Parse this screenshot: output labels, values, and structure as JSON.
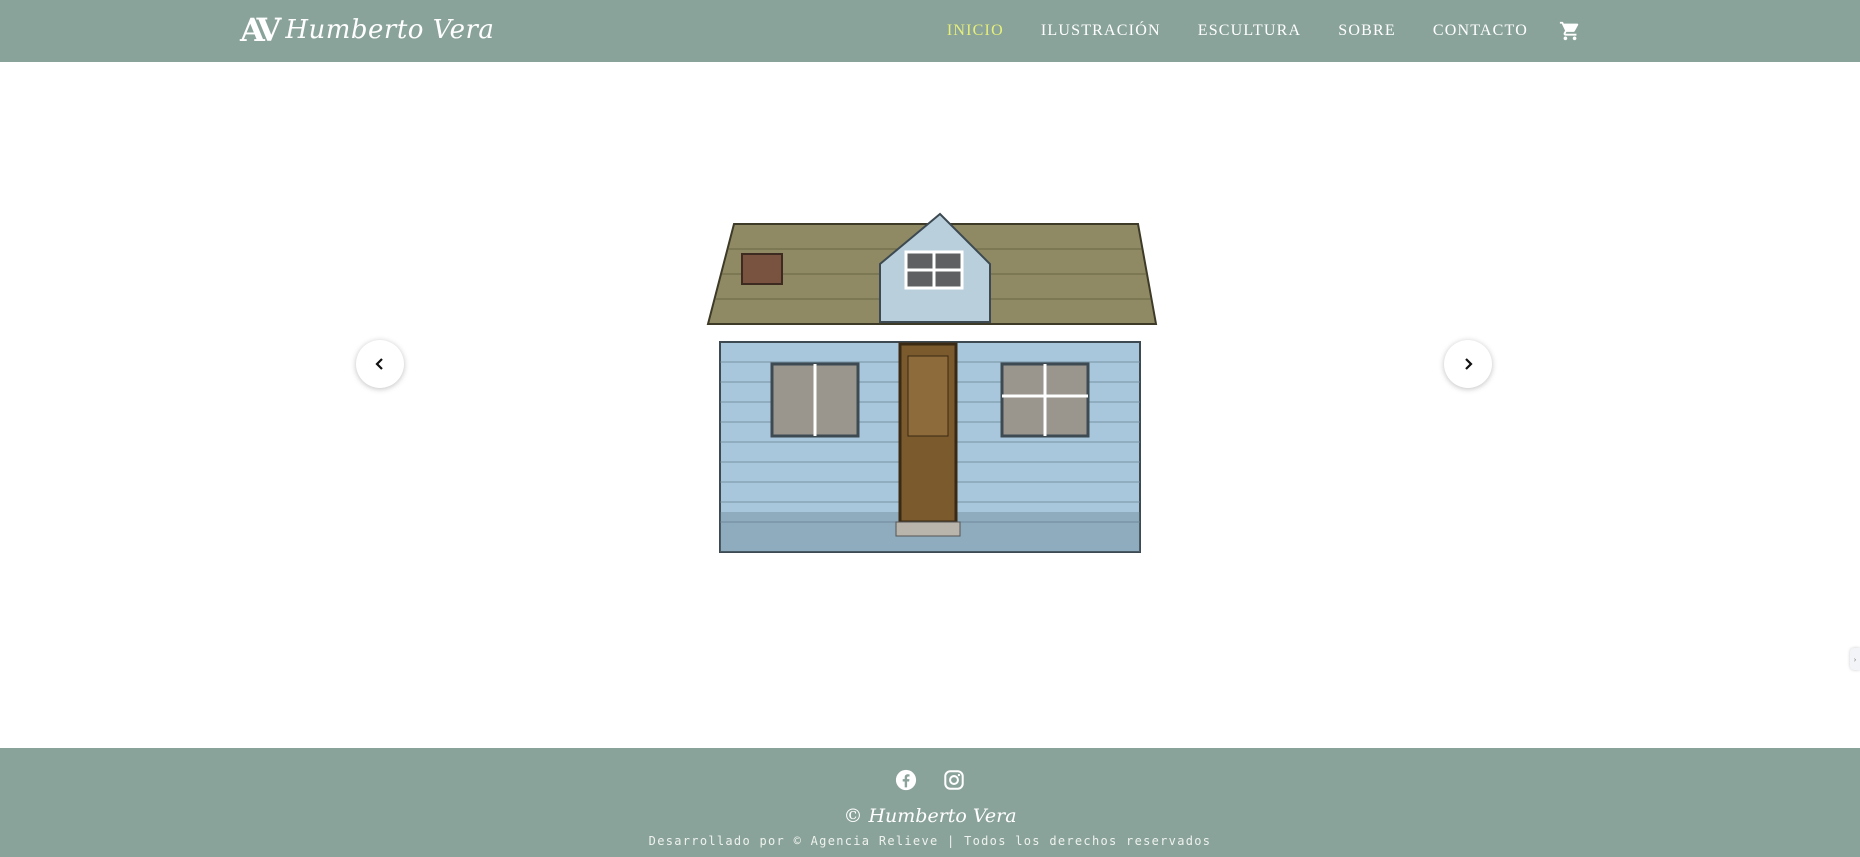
{
  "header": {
    "logo_mark": "AV",
    "logo_text": "Humberto Vera",
    "nav": [
      {
        "label": "INICIO",
        "active": true
      },
      {
        "label": "ILUSTRACIÓN",
        "active": false
      },
      {
        "label": "ESCULTURA",
        "active": false
      },
      {
        "label": "SOBRE",
        "active": false
      },
      {
        "label": "CONTACTO",
        "active": false
      }
    ],
    "cart_icon": "shopping-cart-icon"
  },
  "slider": {
    "image": "watercolor-blue-wooden-house",
    "prev_icon": "chevron-left-icon",
    "next_icon": "chevron-right-icon"
  },
  "footer": {
    "social": [
      "facebook-icon",
      "instagram-icon"
    ],
    "copyright": "© Humberto Vera",
    "credits_prefix": "Desarrollado por © ",
    "credits_link": "Agencia Relieve",
    "credits_suffix": " | Todos los derechos reservados"
  },
  "colors": {
    "header_bg": "#8aa39a",
    "footer_bg": "#8aa39a",
    "nav_active": "#e6ef7a",
    "house_wall": "#a9c7dc",
    "roof": "#8f8a63",
    "door": "#7b5a2e"
  }
}
